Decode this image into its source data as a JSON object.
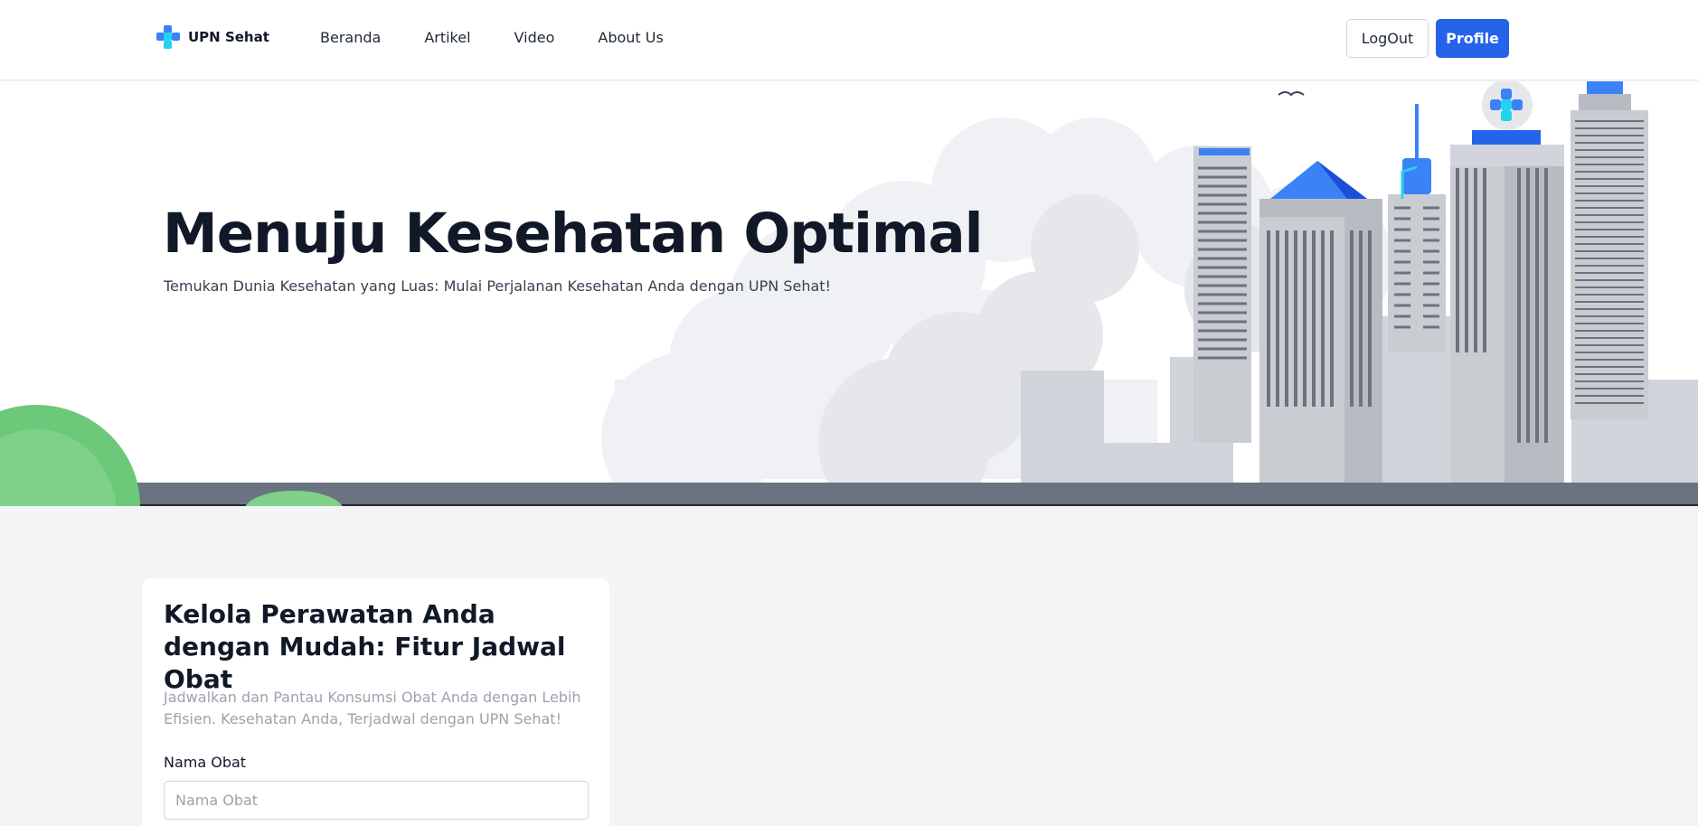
{
  "navbar": {
    "brand": "UPN Sehat",
    "links": [
      "Beranda",
      "Artikel",
      "Video",
      "About Us"
    ],
    "logout_label": "LogOut",
    "profile_label": "Profile"
  },
  "hero": {
    "title": "Menuju Kesehatan Optimal",
    "subtitle": "Temukan Dunia Kesehatan yang Luas: Mulai Perjalanan Kesehatan Anda dengan UPN Sehat!"
  },
  "schedule_card": {
    "title": "Kelola Perawatan Anda dengan Mudah: Fitur Jadwal Obat",
    "description": "Jadwalkan dan Pantau Konsumsi Obat Anda dengan Lebih Efisien. Kesehatan Anda, Terjadwal dengan UPN Sehat!",
    "field_label": "Nama Obat",
    "field_placeholder": "Nama Obat",
    "field_value": ""
  },
  "colors": {
    "primary": "#2563eb",
    "brand_logo_blue": "#3b82f6",
    "brand_logo_cyan": "#22d3ee",
    "page_background": "#f3f4f6",
    "hero_road": "#6b7280",
    "hero_tree": "#6cc979"
  },
  "icons": {
    "brand_logo": "cross-logo-icon",
    "hero_art": "city-skyline-illustration"
  }
}
